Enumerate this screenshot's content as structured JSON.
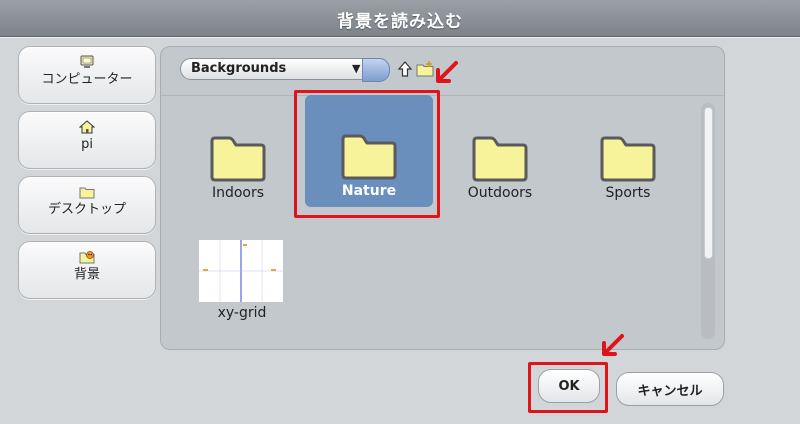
{
  "dialog": {
    "title": "背景を読み込む"
  },
  "sidebar": {
    "items": [
      {
        "label": "コンピューター",
        "icon": "computer-icon"
      },
      {
        "label": "pi",
        "icon": "home-icon"
      },
      {
        "label": "デスクトップ",
        "icon": "folder-icon"
      },
      {
        "label": "背景",
        "icon": "backgrounds-icon"
      }
    ]
  },
  "toolbar": {
    "location": "Backgrounds",
    "dropdown_arrow": "▼",
    "up_icon": "up-folder-icon",
    "new_folder_icon": "new-folder-icon"
  },
  "files": {
    "items": [
      {
        "name": "Indoors",
        "type": "folder",
        "selected": false
      },
      {
        "name": "Nature",
        "type": "folder",
        "selected": true
      },
      {
        "name": "Outdoors",
        "type": "folder",
        "selected": false
      },
      {
        "name": "Sports",
        "type": "folder",
        "selected": false
      },
      {
        "name": "xy-grid",
        "type": "image",
        "selected": false
      }
    ]
  },
  "buttons": {
    "ok": "OK",
    "cancel": "キャンセル"
  },
  "colors": {
    "accent_selected": "#6a8fbc",
    "annotation": "#e0121a",
    "folder_fill": "#f6f39a"
  }
}
